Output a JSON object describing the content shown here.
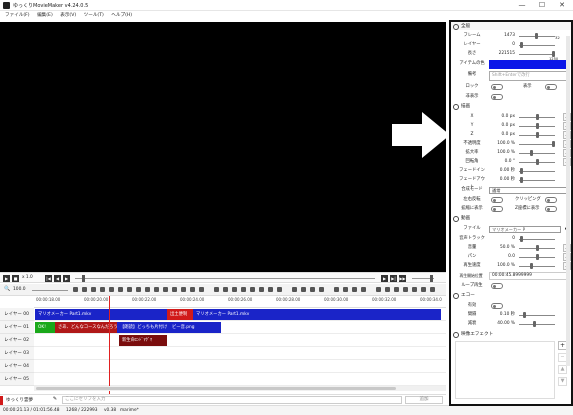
{
  "window": {
    "title": "ゆっくりMovieMaker v4.24.0.5",
    "min": "—",
    "max": "☐",
    "close": "✕"
  },
  "menu": [
    "ファイル(F)",
    "編集(E)",
    "表示(V)",
    "ツール(T)",
    "ヘルプ(H)"
  ],
  "playback": {
    "speed": "x 1.0"
  },
  "toolbar": {
    "zoom": "100.0"
  },
  "ruler": [
    "00:00:18.00",
    "00:00:20.00",
    "00:00:22.00",
    "00:00:24.00",
    "00:00:26.00",
    "00:00:28.00",
    "00:00:30.00",
    "00:00:32.00",
    "00:00:34.0"
  ],
  "layers": [
    "レイヤー 00",
    "レイヤー 01",
    "レイヤー 02",
    "レイヤー 03",
    "レイヤー 04",
    "レイヤー 05"
  ],
  "clips": [
    {
      "layer": 0,
      "label": "マリオメーカー Part1.mkv",
      "color": "#1a24c8"
    },
    {
      "layer": 0,
      "label": "出土便制",
      "color": "#d11a1a"
    },
    {
      "layer": 0,
      "label": "マリオメーカー Part1.mkv",
      "color": "#1a24c8"
    },
    {
      "layer": 1,
      "label": "OK!",
      "color": "#1aa81a"
    },
    {
      "layer": 1,
      "label": "さあ、どんなコースなんだろう",
      "color": "#b01818"
    },
    {
      "layer": 1,
      "label": "【朗読】どっちも片付け",
      "color": "#1a24c8"
    },
    {
      "layer": 1,
      "label": "ビー音.png",
      "color": "#1a24c8"
    },
    {
      "layer": 2,
      "label": "新生命ｴﾝﾄﾞﾏｸﾞﾏ",
      "color": "#7a0d0d"
    }
  ],
  "bottom": {
    "character": "ゆっくり霊夢",
    "input_placeholder": "ここにセリフを入力",
    "add_button": "追加"
  },
  "status": {
    "time": "00:00:21.13 / 01:01:56.48",
    "frames": "1268 / 222993",
    "version": "v0.38",
    "name": "marime*"
  },
  "panel": {
    "sections": {
      "general": "全般",
      "draw": "描画",
      "video": "動画",
      "echo": "エコー",
      "effects": "映像エフェクト"
    },
    "general": {
      "frame_label": "フレーム",
      "frame_value": "1473",
      "frame_max": "32",
      "layer_label": "レイヤー",
      "layer_value": "0",
      "length_label": "長さ",
      "length_value": "221515",
      "length_max": "1250",
      "color_label": "アイテムの色",
      "color": "#0b16e8",
      "memo_label": "備考",
      "memo_placeholder": "Shift+Enterで改行",
      "lock_label": "ロック",
      "hide_label": "非表示",
      "visible_label": "表示"
    },
    "draw": {
      "rows": [
        {
          "label": "X",
          "value": "0.0 px"
        },
        {
          "label": "Y",
          "value": "0.0 px"
        },
        {
          "label": "Z",
          "value": "0.0 px"
        },
        {
          "label": "不透明度",
          "value": "100.0 %"
        },
        {
          "label": "拡大率",
          "value": "100.0 %"
        },
        {
          "label": "回転角",
          "value": "0.0 °"
        },
        {
          "label": "フェードイン",
          "value": "0.00 秒"
        },
        {
          "label": "フェードアウト",
          "value": "0.00 秒"
        }
      ],
      "blend_label": "合成モード",
      "blend_value": "通常",
      "reverse_label": "左右反転",
      "clipping_label": "クリッピング",
      "zoom_label": "拡縮に表示",
      "zoom2_label": "Z座標に表示"
    },
    "video": {
      "file_label": "ファイル",
      "file_value": "マリオメーカー P",
      "track_label": "音声トラック",
      "track_value": "0",
      "volume_label": "音量",
      "volume_value": "50.0 %",
      "pan_label": "パン",
      "pan_value": "0.0",
      "speed_label": "再生速度",
      "speed_value": "100.0 %",
      "start_label": "再生開始位置",
      "start_value": "00:00:45.8999999",
      "loop_label": "ループ再生"
    },
    "echo": {
      "enable_label": "有効",
      "interval_label": "間隔",
      "interval_value": "0.10 秒",
      "decay_label": "減衰",
      "decay_value": "40.00 %"
    }
  }
}
